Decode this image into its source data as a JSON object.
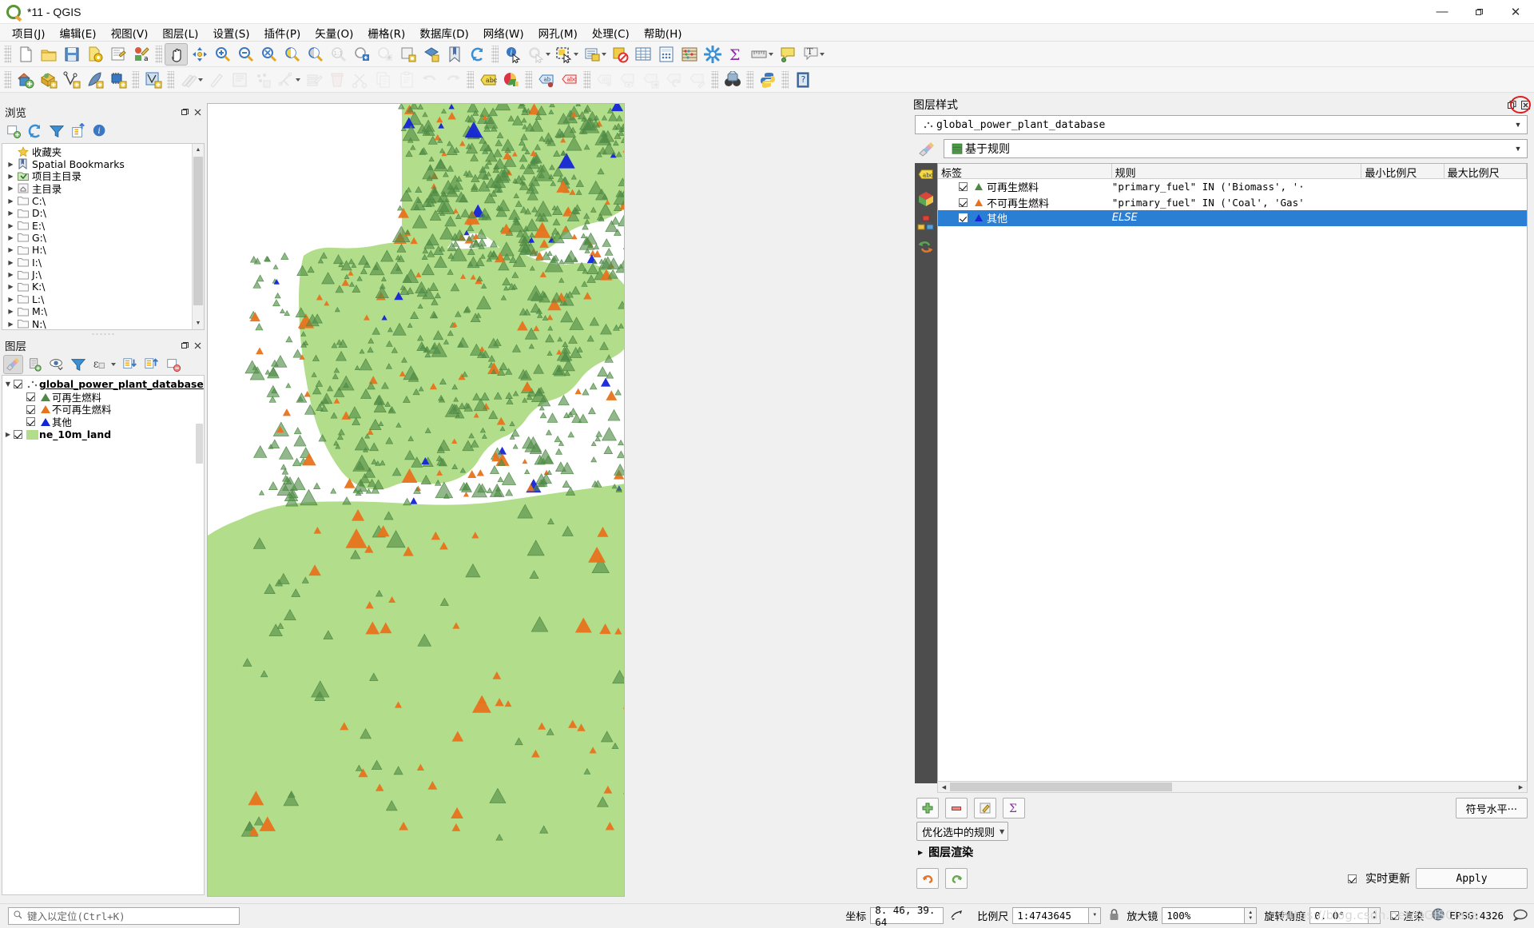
{
  "window": {
    "title": "*11 - QGIS",
    "logo_icon": "qgis-logo-icon",
    "minimize_label": "—",
    "maximize_label": "❐",
    "close_label": "✕"
  },
  "menubar": {
    "items": [
      {
        "label": "项目(J)",
        "name": "menu-project"
      },
      {
        "label": "编辑(E)",
        "name": "menu-edit"
      },
      {
        "label": "视图(V)",
        "name": "menu-view"
      },
      {
        "label": "图层(L)",
        "name": "menu-layer"
      },
      {
        "label": "设置(S)",
        "name": "menu-settings"
      },
      {
        "label": "插件(P)",
        "name": "menu-plugins"
      },
      {
        "label": "矢量(O)",
        "name": "menu-vector"
      },
      {
        "label": "栅格(R)",
        "name": "menu-raster"
      },
      {
        "label": "数据库(D)",
        "name": "menu-database"
      },
      {
        "label": "网络(W)",
        "name": "menu-web"
      },
      {
        "label": "网孔(M)",
        "name": "menu-mesh"
      },
      {
        "label": "处理(C)",
        "name": "menu-processing"
      },
      {
        "label": "帮助(H)",
        "name": "menu-help"
      }
    ]
  },
  "toolbar_row1": [
    {
      "name": "new-project-icon",
      "icon": "page",
      "disabled": false
    },
    {
      "name": "open-project-icon",
      "icon": "folder",
      "disabled": false
    },
    {
      "name": "save-project-icon",
      "icon": "floppy",
      "disabled": false
    },
    {
      "name": "save-project-as-icon",
      "icon": "page-gear",
      "disabled": false
    },
    {
      "name": "new-print-layout-icon",
      "icon": "layout",
      "disabled": false
    },
    {
      "name": "style-manager-icon",
      "icon": "style",
      "disabled": false
    },
    {
      "sep": true
    },
    {
      "name": "pan-map-icon",
      "icon": "hand",
      "active": true
    },
    {
      "name": "pan-to-selection-icon",
      "icon": "pan-sel",
      "disabled": false
    },
    {
      "name": "zoom-in-icon",
      "icon": "zoom-in",
      "disabled": false
    },
    {
      "name": "zoom-out-icon",
      "icon": "zoom-out",
      "disabled": false
    },
    {
      "name": "zoom-full-icon",
      "icon": "zoom-full",
      "disabled": false
    },
    {
      "name": "zoom-to-selection-icon",
      "icon": "zoom-half-y",
      "disabled": false
    },
    {
      "name": "zoom-to-layer-icon",
      "icon": "zoom-half-g",
      "disabled": false
    },
    {
      "name": "zoom-native-icon",
      "icon": "zoom-1-1",
      "disabled": true
    },
    {
      "name": "zoom-last-icon",
      "icon": "zoom-back",
      "disabled": false
    },
    {
      "name": "zoom-next-icon",
      "icon": "zoom-fwd",
      "disabled": true
    },
    {
      "name": "new-map-view-icon",
      "icon": "mapview",
      "disabled": false
    },
    {
      "name": "new-3d-map-view-icon",
      "icon": "mapview3d",
      "disabled": false
    },
    {
      "name": "show-bookmarks-icon",
      "icon": "bookmark",
      "disabled": false
    },
    {
      "name": "refresh-icon",
      "icon": "refresh",
      "disabled": false
    },
    {
      "sep": true
    },
    {
      "name": "identify-features-icon",
      "icon": "identify",
      "disabled": false
    },
    {
      "name": "run-feature-action-icon",
      "icon": "gear-cursor",
      "disabled": true,
      "caret": true
    },
    {
      "name": "select-features-icon",
      "icon": "select-rect",
      "disabled": false,
      "caret": true
    },
    {
      "name": "select-by-value-icon",
      "icon": "select-form",
      "disabled": false,
      "caret": true
    },
    {
      "name": "deselect-features-icon",
      "icon": "deselect",
      "disabled": false
    },
    {
      "name": "open-attribute-table-icon",
      "icon": "attr-table",
      "disabled": false
    },
    {
      "name": "field-calculator-icon",
      "icon": "calc",
      "disabled": false
    },
    {
      "name": "abacus-icon",
      "icon": "abacus",
      "disabled": false
    },
    {
      "name": "processing-toolbox-icon",
      "icon": "gear-blue",
      "disabled": false
    },
    {
      "name": "statistics-icon",
      "icon": "sigma",
      "disabled": false
    },
    {
      "name": "measure-line-icon",
      "icon": "ruler",
      "disabled": false,
      "caret": true
    },
    {
      "name": "map-tips-icon",
      "icon": "maptip",
      "disabled": false
    },
    {
      "name": "new-text-annotation-icon",
      "icon": "text-annot",
      "disabled": false,
      "caret": true
    }
  ],
  "toolbar_row2": [
    {
      "name": "open-data-source-manager-icon",
      "icon": "datasource",
      "disabled": false
    },
    {
      "name": "add-vector-layer-icon",
      "icon": "add-vector",
      "disabled": false
    },
    {
      "name": "add-delimited-text-icon",
      "icon": "add-node",
      "disabled": false
    },
    {
      "name": "add-mesh-layer-icon",
      "icon": "add-feather",
      "disabled": false
    },
    {
      "name": "add-postgis-icon",
      "icon": "add-chip",
      "disabled": false
    },
    {
      "sep": true
    },
    {
      "name": "current-edits-icon",
      "icon": "edit-layer",
      "disabled": false
    },
    {
      "sep": true
    },
    {
      "name": "toggle-editing-icon",
      "icon": "pencil-pair",
      "disabled": true,
      "caret": true
    },
    {
      "name": "edit-pencil-icon",
      "icon": "pencil",
      "disabled": true
    },
    {
      "name": "save-layer-edits-icon",
      "icon": "save-edits",
      "disabled": true
    },
    {
      "name": "add-point-feature-icon",
      "icon": "add-point",
      "disabled": true
    },
    {
      "name": "vertex-tool-icon",
      "icon": "vertex",
      "disabled": true,
      "caret": true
    },
    {
      "name": "modify-attributes-icon",
      "icon": "modify-attr",
      "disabled": true
    },
    {
      "name": "delete-selected-icon",
      "icon": "trash",
      "disabled": true
    },
    {
      "name": "cut-features-icon",
      "icon": "scissors",
      "disabled": true
    },
    {
      "name": "copy-features-icon",
      "icon": "copy",
      "disabled": true
    },
    {
      "name": "paste-features-icon",
      "icon": "paste",
      "disabled": true
    },
    {
      "name": "undo-icon",
      "icon": "undo",
      "disabled": true
    },
    {
      "name": "redo-icon",
      "icon": "redo",
      "disabled": true
    },
    {
      "sep": true
    },
    {
      "name": "label-layer-icon",
      "icon": "label-yellow",
      "disabled": false
    },
    {
      "name": "layer-diagram-icon",
      "icon": "diagram",
      "disabled": false
    },
    {
      "sep": true
    },
    {
      "name": "pin-labels-icon",
      "icon": "label-pin-blue",
      "disabled": false
    },
    {
      "name": "highlight-labels-icon",
      "icon": "label-red",
      "disabled": false
    },
    {
      "sep": true
    },
    {
      "name": "move-label-icon",
      "icon": "label-gray-pin",
      "disabled": true
    },
    {
      "name": "show-hide-labels-icon",
      "icon": "label-gray-eye",
      "disabled": true
    },
    {
      "name": "move-label-2-icon",
      "icon": "label-gray-arrow",
      "disabled": true
    },
    {
      "name": "rotate-label-icon",
      "icon": "label-gray-rot",
      "disabled": true
    },
    {
      "name": "change-label-icon",
      "icon": "label-gray-pen",
      "disabled": true
    },
    {
      "sep": true
    },
    {
      "name": "metasearch-icon",
      "icon": "binoculars",
      "disabled": false
    },
    {
      "sep": true
    },
    {
      "name": "python-console-icon",
      "icon": "python",
      "disabled": false
    },
    {
      "sep": true
    },
    {
      "name": "help-icon",
      "icon": "help-book",
      "disabled": false
    }
  ],
  "browser_panel": {
    "title": "浏览",
    "float_label": "❐",
    "close_label": "✕",
    "toolbar": [
      {
        "name": "add-layer-collection-icon",
        "icon": "new-coll"
      },
      {
        "name": "refresh-browser-icon",
        "icon": "refresh"
      },
      {
        "name": "filter-browser-icon",
        "icon": "filter"
      },
      {
        "name": "collapse-all-icon",
        "icon": "collapse"
      },
      {
        "name": "browser-properties-icon",
        "icon": "info"
      }
    ],
    "items": [
      {
        "label": "收藏夹",
        "icon": "star-icon",
        "expandable": false
      },
      {
        "label": "Spatial Bookmarks",
        "icon": "bookmark-icon",
        "expandable": true
      },
      {
        "label": "项目主目录",
        "icon": "project-home-icon",
        "expandable": true
      },
      {
        "label": "主目录",
        "icon": "home-icon",
        "expandable": true
      },
      {
        "label": "C:\\",
        "icon": "folder-icon",
        "expandable": true
      },
      {
        "label": "D:\\",
        "icon": "folder-icon",
        "expandable": true
      },
      {
        "label": "E:\\",
        "icon": "folder-icon",
        "expandable": true
      },
      {
        "label": "G:\\",
        "icon": "folder-icon",
        "expandable": true
      },
      {
        "label": "H:\\",
        "icon": "folder-icon",
        "expandable": true
      },
      {
        "label": "I:\\",
        "icon": "folder-icon",
        "expandable": true
      },
      {
        "label": "J:\\",
        "icon": "folder-icon",
        "expandable": true
      },
      {
        "label": "K:\\",
        "icon": "folder-icon",
        "expandable": true
      },
      {
        "label": "L:\\",
        "icon": "folder-icon",
        "expandable": true
      },
      {
        "label": "M:\\",
        "icon": "folder-icon",
        "expandable": true
      },
      {
        "label": "N:\\",
        "icon": "folder-icon",
        "expandable": true
      }
    ]
  },
  "layers_panel": {
    "title": "图层",
    "float_label": "❐",
    "close_label": "✕",
    "toolbar": [
      {
        "name": "open-layer-styling-panel-icon",
        "icon": "paintbrush",
        "on": true
      },
      {
        "name": "add-group-icon",
        "icon": "add-group"
      },
      {
        "name": "manage-layer-visibility-icon",
        "icon": "eye"
      },
      {
        "name": "filter-legend-icon",
        "icon": "filter"
      },
      {
        "name": "filter-legend-by-expression-icon",
        "icon": "epsilon",
        "caret": true
      },
      {
        "name": "expand-all-icon",
        "icon": "expand-all"
      },
      {
        "name": "collapse-all-icon",
        "icon": "collapse-all"
      },
      {
        "name": "remove-layer-icon",
        "icon": "remove-layer"
      }
    ],
    "layers": [
      {
        "label": "global_power_plant_database",
        "checked": true,
        "bold": true,
        "underline": true,
        "expanded": true,
        "symbol": "points-icon",
        "indent": 0
      },
      {
        "label": "可再生燃料",
        "checked": true,
        "symbol": "triangle",
        "color": "#4f8a45",
        "indent": 1
      },
      {
        "label": "不可再生燃料",
        "checked": true,
        "symbol": "triangle",
        "color": "#e8731d",
        "indent": 1
      },
      {
        "label": "其他",
        "checked": true,
        "symbol": "triangle",
        "color": "#1524d6",
        "indent": 1
      },
      {
        "label": "ne_10m_land",
        "checked": true,
        "symbol": "swatch",
        "color": "#b2dd8a",
        "bold": true,
        "indent": 0
      }
    ]
  },
  "styling_panel": {
    "title": "图层样式",
    "float_label": "❐",
    "close_label": "✕",
    "layer_selector": {
      "value": "global_power_plant_database",
      "icon": "points-icon"
    },
    "renderer_selector": {
      "value": "基于规则",
      "icon": "rule-based-icon"
    },
    "side_tabs": [
      {
        "name": "symbology-tab",
        "icon": "paintbrush-icon"
      },
      {
        "name": "labels-tab",
        "icon": "abc-icon"
      },
      {
        "name": "3d-view-tab",
        "icon": "cube-icon"
      },
      {
        "name": "diagrams-tab",
        "icon": "diagram-icon"
      },
      {
        "name": "history-tab",
        "icon": "history-icon"
      }
    ],
    "table": {
      "columns": [
        "标签",
        "规则",
        "最小比例尺",
        "最大比例尺"
      ],
      "rows": [
        {
          "checked": true,
          "label": "可再生燃料",
          "color": "#4f8a45",
          "rule": "\"primary_fuel\" IN ('Biomass', '·",
          "min_scale": "",
          "max_scale": "",
          "selected": false,
          "italic": false
        },
        {
          "checked": true,
          "label": "不可再生燃料",
          "color": "#e8731d",
          "rule": "\"primary_fuel\" IN ('Coal', 'Gas'",
          "min_scale": "",
          "max_scale": "",
          "selected": false,
          "italic": false
        },
        {
          "checked": true,
          "label": "其他",
          "color": "#1524d6",
          "rule": "ELSE",
          "min_scale": "",
          "max_scale": "",
          "selected": true,
          "italic": true
        }
      ]
    },
    "bottom_buttons": [
      {
        "name": "add-rule-button",
        "icon": "plus-green"
      },
      {
        "name": "remove-rule-button",
        "icon": "minus-red"
      },
      {
        "name": "edit-rule-button",
        "icon": "pencil-edit"
      },
      {
        "name": "count-features-button",
        "icon": "sigma-purple"
      }
    ],
    "symbol_levels_label": "符号水平···",
    "refine_dropdown": "优化选中的规则",
    "layer_rendering_label": "图层渲染",
    "undo_label": "↶",
    "redo_label": "↷",
    "live_update_label": "实时更新",
    "live_update_checked": true,
    "apply_label": "Apply"
  },
  "statusbar": {
    "locator_placeholder": "键入以定位(Ctrl+K)",
    "locator_icon": "search-icon",
    "coord_label": "坐标",
    "coord_value": "8. 46, 39. 64",
    "extent_icon": "extent-toggle-icon",
    "scale_label": "比例尺",
    "scale_value": "1:4743645",
    "lock_icon": "lock-icon",
    "magnifier_label": "放大镜",
    "magnifier_value": "100%",
    "rotation_label": "旋转角度",
    "rotation_value": "0. 0°",
    "render_label": "渲染",
    "render_checked": true,
    "crs_icon": "globe-icon",
    "crs_value": "EPSG:4326",
    "messages_icon": "message-icon"
  },
  "map": {
    "land_color": "#b2dd8a",
    "water_color": "#ffffff",
    "renewable_color": "#4f8a45",
    "nonrenewable_color": "#e8731d",
    "other_color": "#1524d6"
  },
  "watermark": "https://blog.csdn.net/QGISClass"
}
